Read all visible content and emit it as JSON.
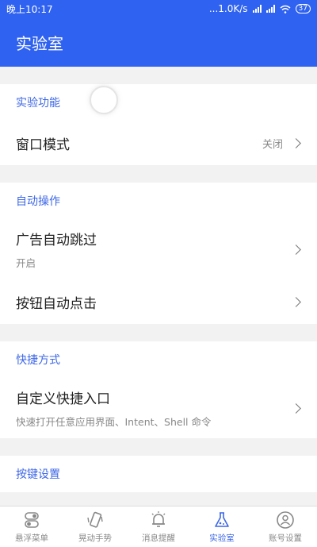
{
  "status": {
    "time": "晚上10:17",
    "net_speed": "...1.0K/s",
    "battery": "37"
  },
  "header": {
    "title": "实验室"
  },
  "sections": [
    {
      "title": "实验功能",
      "rows": [
        {
          "title": "窗口模式",
          "value": "关闭"
        }
      ]
    },
    {
      "title": "自动操作",
      "rows": [
        {
          "title": "广告自动跳过",
          "subtitle": "开启"
        },
        {
          "title": "按钮自动点击"
        }
      ]
    },
    {
      "title": "快捷方式",
      "rows": [
        {
          "title": "自定义快捷入口",
          "subtitle": "快速打开任意应用界面、Intent、Shell 命令"
        }
      ]
    },
    {
      "title": "按键设置",
      "rows": []
    }
  ],
  "nav": [
    {
      "label": "悬浮菜单",
      "icon": "toggle-icon"
    },
    {
      "label": "晃动手势",
      "icon": "shake-phone-icon"
    },
    {
      "label": "消息提醒",
      "icon": "bell-icon"
    },
    {
      "label": "实验室",
      "icon": "flask-icon",
      "active": true
    },
    {
      "label": "账号设置",
      "icon": "user-icon"
    }
  ],
  "colors": {
    "primary": "#2f62f0",
    "accent": "#3d67e6"
  }
}
